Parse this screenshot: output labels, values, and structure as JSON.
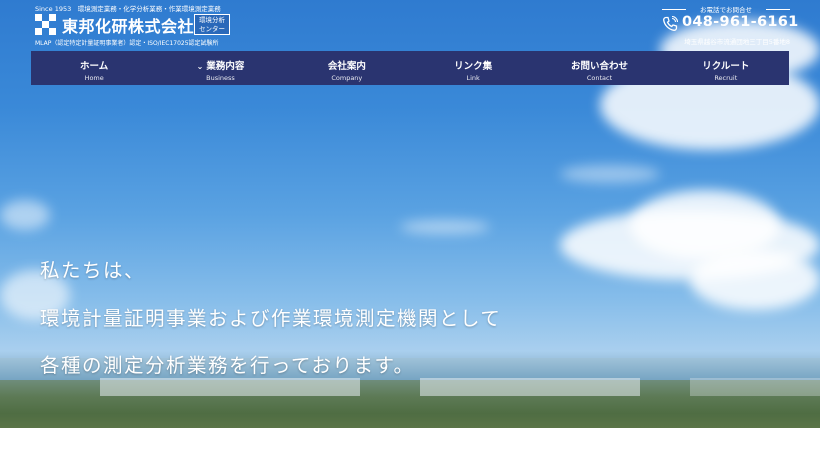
{
  "header": {
    "since": "Since 1953　環境測定業務・化学分析業務・作業環境測定業務",
    "company_name": "東邦化研株式会社",
    "badge_line1": "環境分析",
    "badge_line2": "センター",
    "certification": "MLAP（認定特定計量証明事業者）認定・ISO/IEC17025認定試験所",
    "phone_caption": "お電話でお問合せ",
    "phone_number": "048-961-6161",
    "address": "埼玉県越谷市流通団地三丁目5番地8"
  },
  "nav": [
    {
      "jp": "ホーム",
      "en": "Home",
      "dropdown": false
    },
    {
      "jp": "業務内容",
      "en": "Business",
      "dropdown": true
    },
    {
      "jp": "会社案内",
      "en": "Company",
      "dropdown": false
    },
    {
      "jp": "リンク集",
      "en": "Link",
      "dropdown": false
    },
    {
      "jp": "お問い合わせ",
      "en": "Contact",
      "dropdown": false
    },
    {
      "jp": "リクルート",
      "en": "Recruit",
      "dropdown": false
    }
  ],
  "hero": {
    "line1": "私たちは、",
    "line2": "環境計量証明事業および作業環境測定機関として",
    "line3": "各種の測定分析業務を行っております。"
  },
  "colors": {
    "nav_bg": "#2a3470",
    "sky": "#3a89d8"
  },
  "icons": {
    "logo": "checkered-logo-icon",
    "phone": "phone-icon",
    "dropdown": "chevron-down-icon"
  }
}
